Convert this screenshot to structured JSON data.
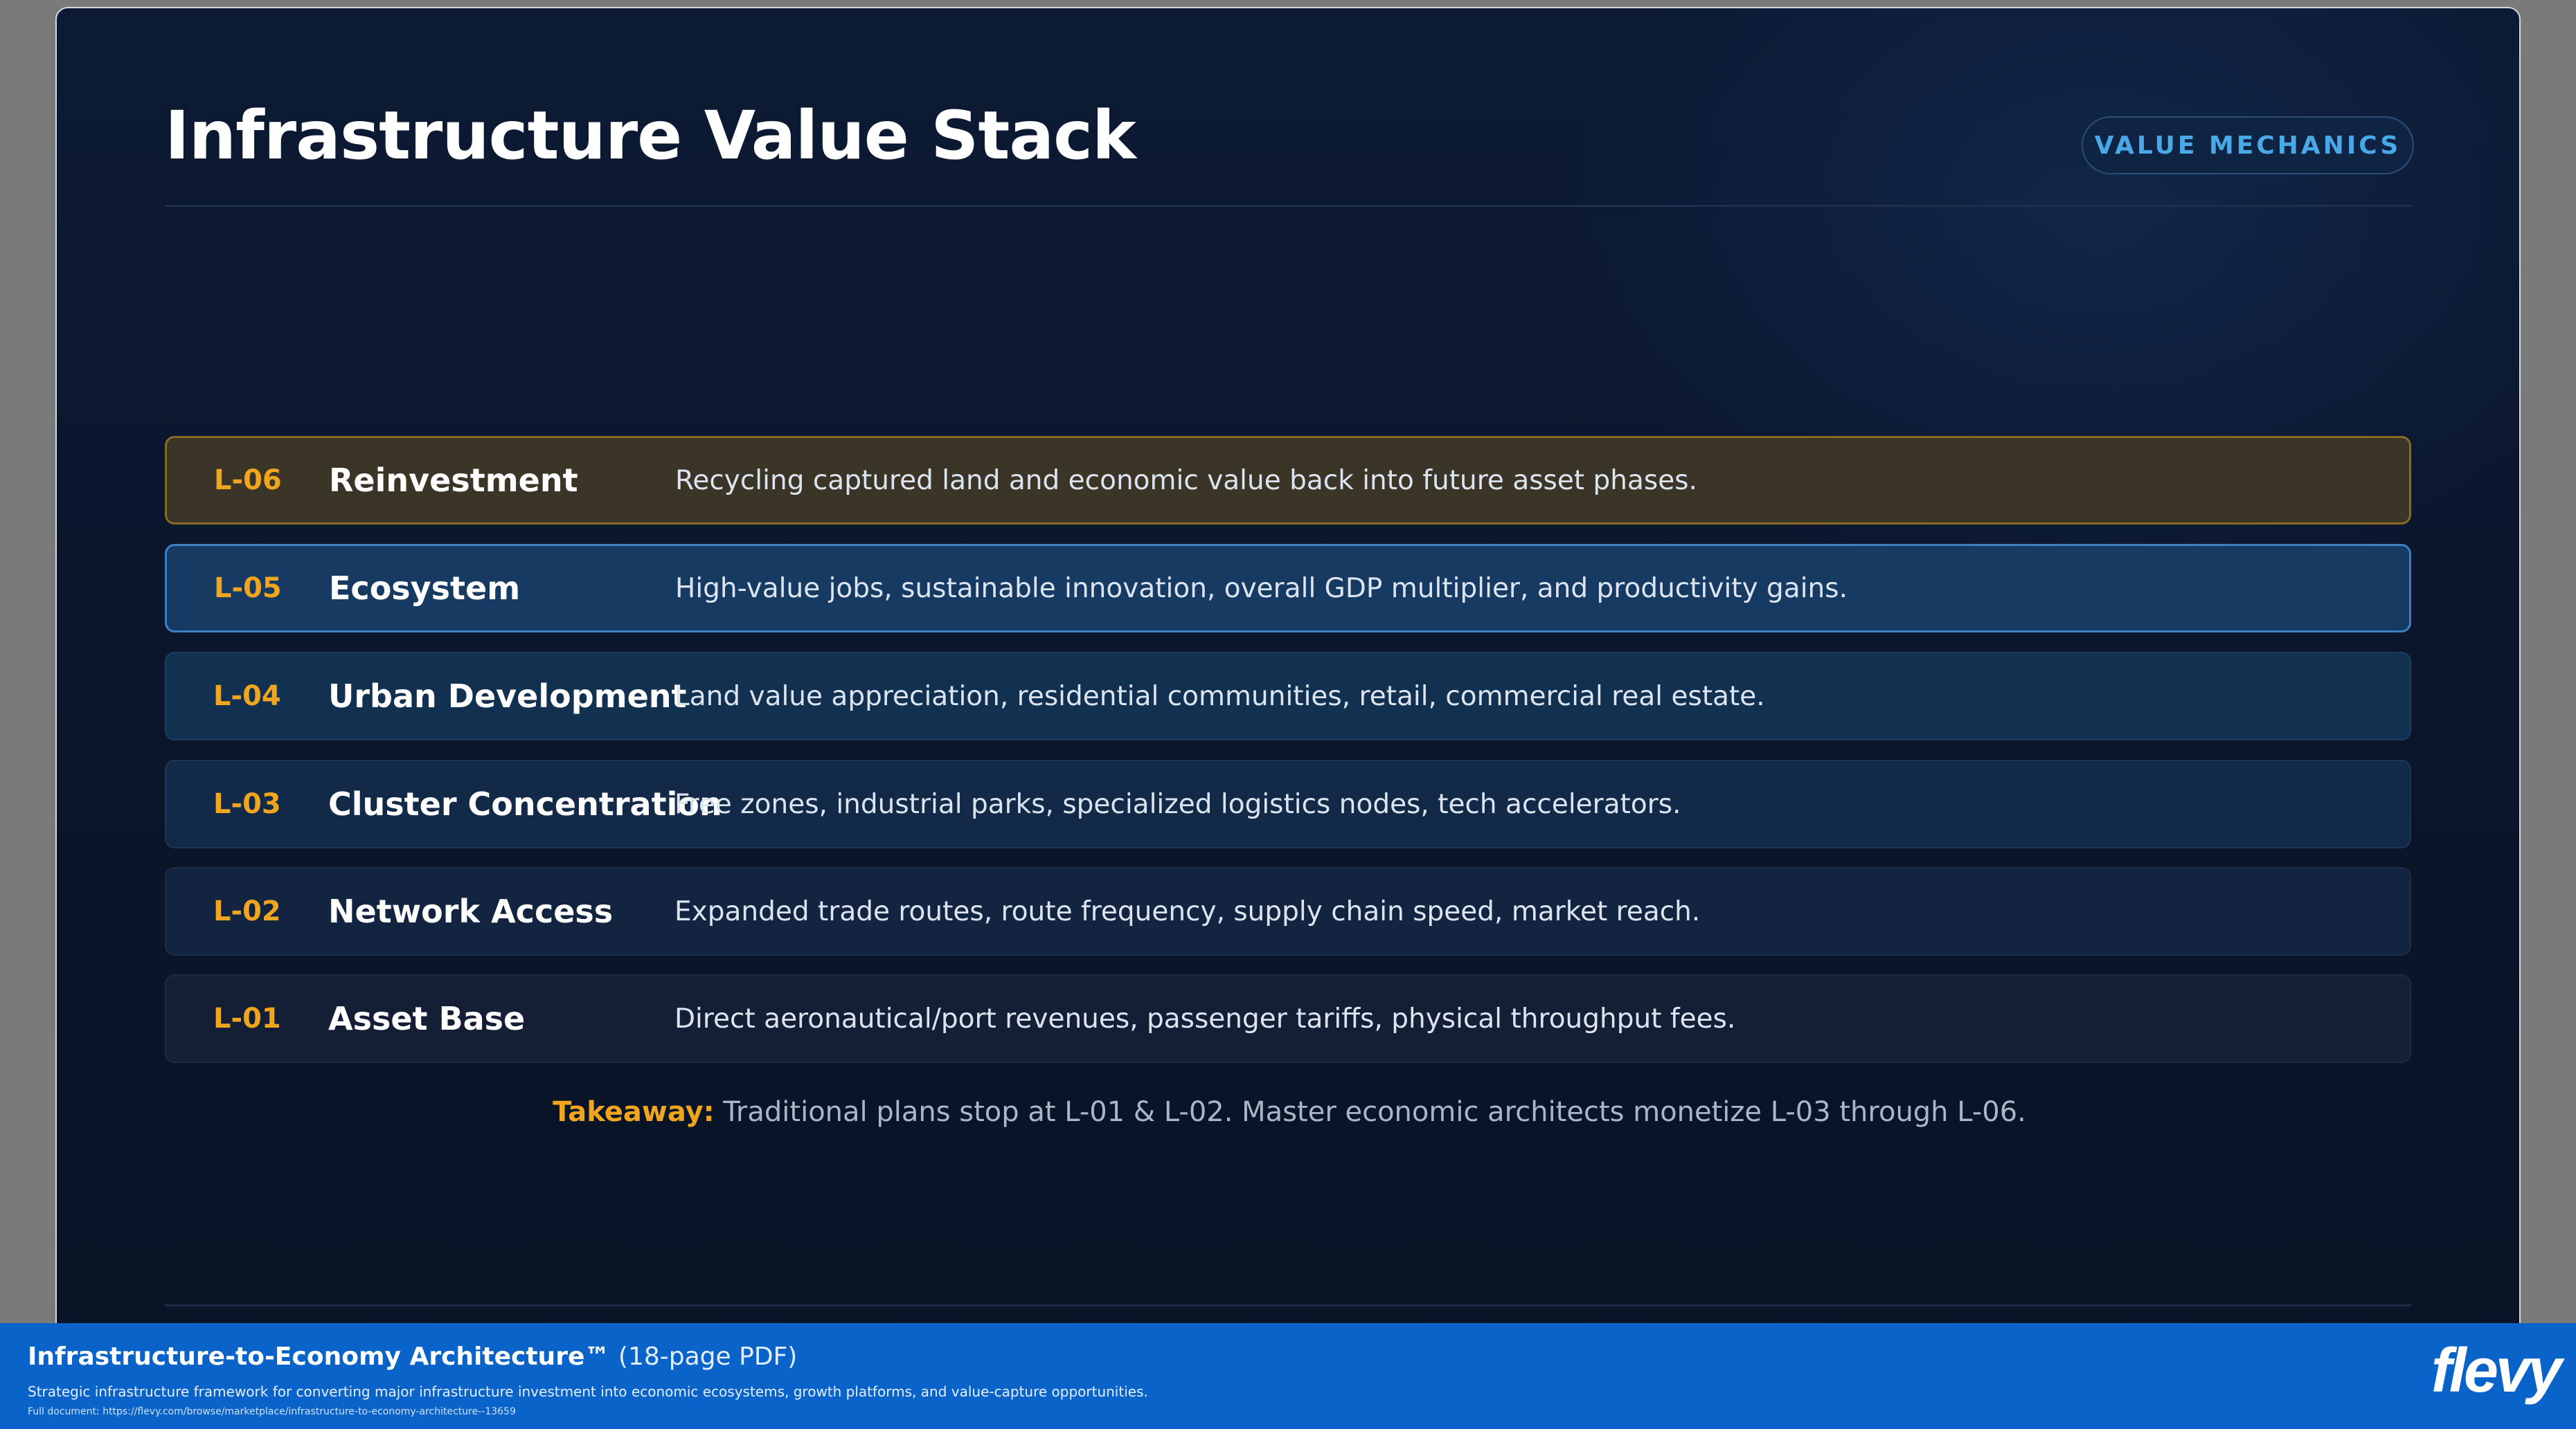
{
  "slide": {
    "title": "Infrastructure Value Stack",
    "badge": "VALUE MECHANICS",
    "layers": [
      {
        "code": "L-06",
        "name": "Reinvestment",
        "description": "Recycling captured land and economic value back into future asset phases."
      },
      {
        "code": "L-05",
        "name": "Ecosystem",
        "description": "High-value jobs, sustainable innovation, overall GDP multiplier, and productivity gains."
      },
      {
        "code": "L-04",
        "name": "Urban Development",
        "description": "Land value appreciation, residential communities, retail, commercial real estate."
      },
      {
        "code": "L-03",
        "name": "Cluster Concentration",
        "description": "Free zones, industrial parks, specialized logistics nodes, tech accelerators."
      },
      {
        "code": "L-02",
        "name": "Network Access",
        "description": "Expanded trade routes, route frequency, supply chain speed, market reach."
      },
      {
        "code": "L-01",
        "name": "Asset Base",
        "description": "Direct aeronautical/port revenues, passenger tariffs, physical throughput fees."
      }
    ],
    "takeaway": {
      "label": "Takeaway:",
      "text": "Traditional plans stop at L-01 & L-02. Master economic architects monetize L-03 through L-06."
    }
  },
  "footer": {
    "title": "Infrastructure-to-Economy Architecture™",
    "pages": "(18-page PDF)",
    "description": "Strategic infrastructure framework for converting major infrastructure investment into economic ecosystems, growth platforms, and value-capture opportunities.",
    "link": "Full document: https://flevy.com/browse/marketplace/infrastructure-to-economy-architecture--13659",
    "logo": "flevy"
  },
  "colors": {
    "accent_orange": "#f0a51e",
    "badge_blue": "#48a8e8",
    "footer_blue": "#0a63c8",
    "slide_background": "#0b162c"
  }
}
